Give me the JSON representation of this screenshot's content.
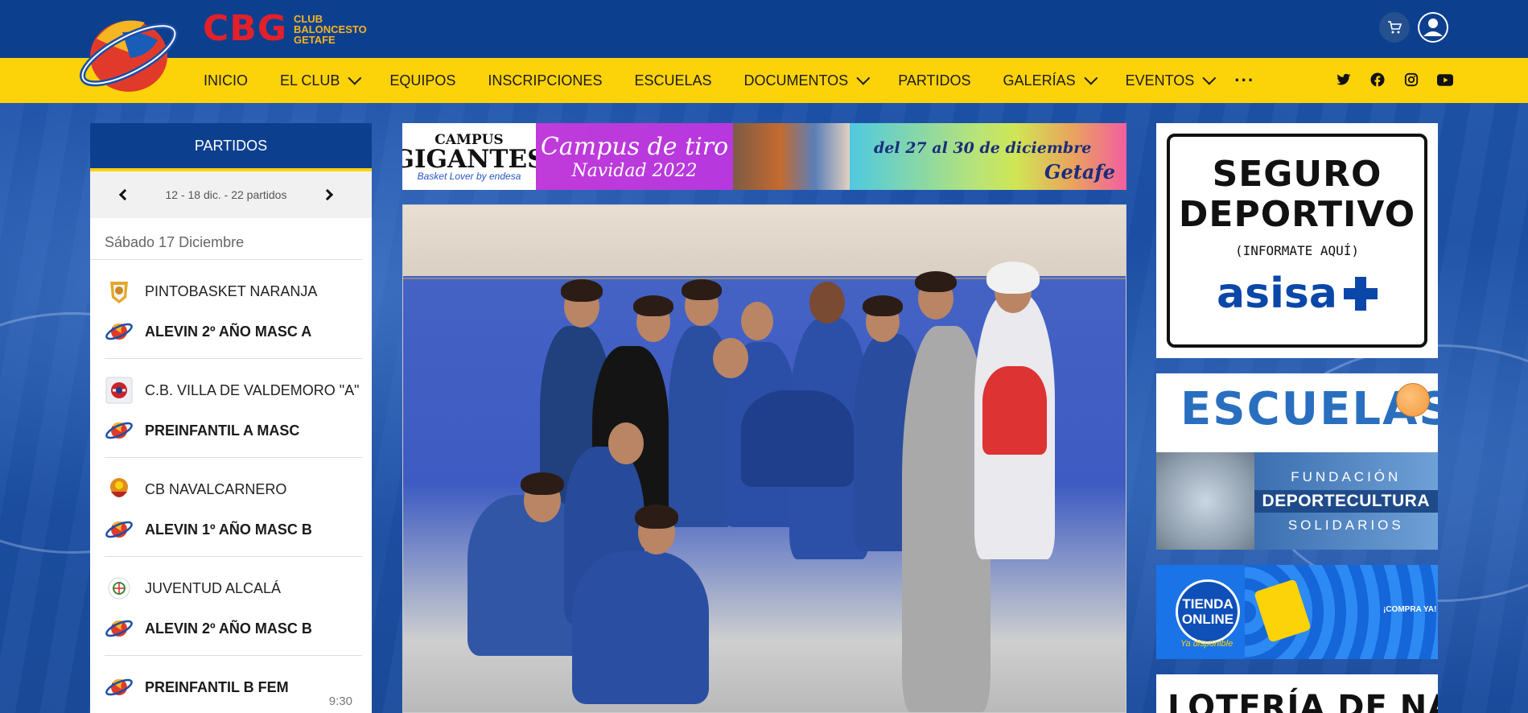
{
  "brand": {
    "name": "CBG",
    "subtitle": [
      "CLUB",
      "BALONCESTO",
      "GETAFE"
    ],
    "colors": {
      "primary_blue": "#0d3f8f",
      "yellow": "#fcd209",
      "red": "#e2202a"
    }
  },
  "header": {
    "icons": {
      "cart": "cart-icon",
      "user": "user-icon"
    }
  },
  "nav": {
    "items": [
      {
        "label": "INICIO",
        "dropdown": false
      },
      {
        "label": "EL CLUB",
        "dropdown": true
      },
      {
        "label": "EQUIPOS",
        "dropdown": false
      },
      {
        "label": "INSCRIPCIONES",
        "dropdown": false
      },
      {
        "label": "ESCUELAS",
        "dropdown": false
      },
      {
        "label": "DOCUMENTOS",
        "dropdown": true
      },
      {
        "label": "PARTIDOS",
        "dropdown": false
      },
      {
        "label": "GALERÍAS",
        "dropdown": true
      },
      {
        "label": "EVENTOS",
        "dropdown": true
      }
    ],
    "more": "···",
    "social": [
      "twitter-icon",
      "facebook-icon",
      "instagram-icon",
      "youtube-icon"
    ]
  },
  "matches": {
    "title": "PARTIDOS",
    "week": "12 - 18 dic. - 22 partidos",
    "day": "Sábado 17 Diciembre",
    "list": [
      {
        "away": "PINTOBASKET NARANJA",
        "home": "ALEVIN 2º AÑO MASC A"
      },
      {
        "away": "C.B. VILLA DE VALDEMORO \"A\"",
        "home": "PREINFANTIL A MASC"
      },
      {
        "away": "CB NAVALCARNERO",
        "home": "ALEVIN 1º AÑO MASC B"
      },
      {
        "away": "JUVENTUD ALCALÁ",
        "home": "ALEVIN 2º AÑO MASC B"
      },
      {
        "away": "",
        "home": "PREINFANTIL B FEM",
        "time": "9:30"
      }
    ]
  },
  "banner_campus": {
    "left_top": "CAMPUS",
    "left_main": "GIGANTES",
    "left_sub": "Basket Lover by endesa",
    "mid_title": "Campus de tiro",
    "mid_sub": "Navidad 2022",
    "dates": "del 27 al 30 de diciembre",
    "place": "Getafe"
  },
  "ads": {
    "seguro": {
      "line1": "SEGURO",
      "line2": "DEPORTIVO",
      "note": "(INFORMATE AQUÍ)",
      "brand": "asisa"
    },
    "escuelas": {
      "title": "ESCUELAS",
      "f1": "FUNDACIÓN",
      "f2": "DEPORTECULTURA",
      "f3": "SOLIDARIOS"
    },
    "tienda": {
      "title": "TIENDA ONLINE",
      "sub": "Ya disponible",
      "cta": "¡COMPRA YA!"
    },
    "loteria": {
      "title": "LOTERÍA DE NAVIDAD"
    }
  }
}
